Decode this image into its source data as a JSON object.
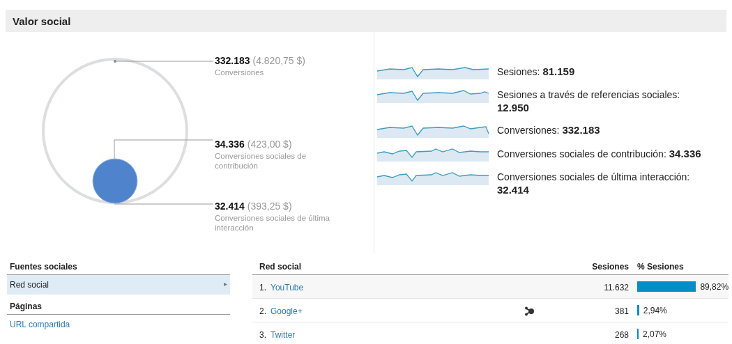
{
  "title": "Valor social",
  "bubbles": [
    {
      "value": "332.183",
      "money": "(4.820,75 $)",
      "label": "Conversiones"
    },
    {
      "value": "34.336",
      "money": "(423,00 $)",
      "label": "Conversiones sociales de contribución"
    },
    {
      "value": "32.414",
      "money": "(393,25 $)",
      "label": "Conversiones sociales de última interacción"
    }
  ],
  "metrics": [
    {
      "label": "Sesiones:",
      "value": "81.159"
    },
    {
      "label": "Sesiones a través de referencias sociales:",
      "value": "12.950"
    },
    {
      "label": "Conversiones:",
      "value": "332.183"
    },
    {
      "label": "Conversiones sociales de contribución:",
      "value": "34.336"
    },
    {
      "label": "Conversiones sociales de última interacción:",
      "value": "32.414"
    }
  ],
  "sources": {
    "heading": "Fuentes sociales",
    "items": [
      {
        "label": "Red social",
        "selected": true,
        "arrow": "▸"
      }
    ],
    "pages_heading": "Páginas",
    "pages_items": [
      {
        "label": "URL compartida",
        "selected": false
      }
    ]
  },
  "table": {
    "columns": [
      "Red social",
      "Sesiones",
      "% Sesiones"
    ],
    "rows": [
      {
        "rank": "1.",
        "name": "YouTube",
        "sessions": "11.632",
        "pct": "89,82%",
        "network_icon": false
      },
      {
        "rank": "2.",
        "name": "Google+",
        "sessions": "381",
        "pct": "2,94%",
        "network_icon": true
      },
      {
        "rank": "3.",
        "name": "Twitter",
        "sessions": "268",
        "pct": "2,07%",
        "network_icon": false
      }
    ]
  }
}
